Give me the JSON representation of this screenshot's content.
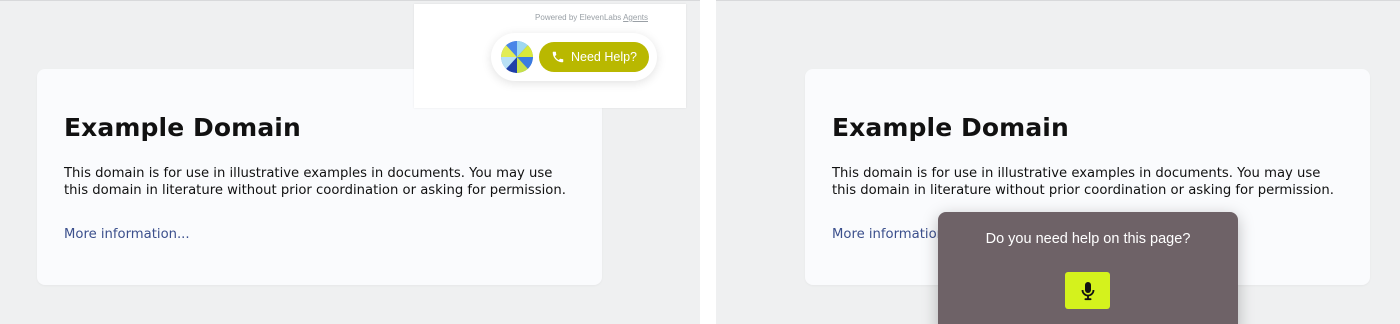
{
  "screens": [
    {
      "card": {
        "title": "Example Domain",
        "text": "This domain is for use in illustrative examples in documents. You may use this domain in literature without prior coordination or asking for permission.",
        "link": "More information..."
      },
      "widget": {
        "powered_by": "Powered by ElevenLabs",
        "powered_by_link": "Agents",
        "button_label": "Need Help?",
        "button_icon": "phone-icon",
        "button_color": "#b9b800"
      }
    },
    {
      "card": {
        "title": "Example Domain",
        "text": "This domain is for use in illustrative examples in documents. You may use this domain in literature without prior coordination or asking for permission.",
        "link": "More information..."
      },
      "help_popup": {
        "question": "Do you need help on this page?",
        "mic_icon": "microphone-icon",
        "mic_color": "#d4f21d",
        "background": "#6e6267"
      }
    }
  ]
}
